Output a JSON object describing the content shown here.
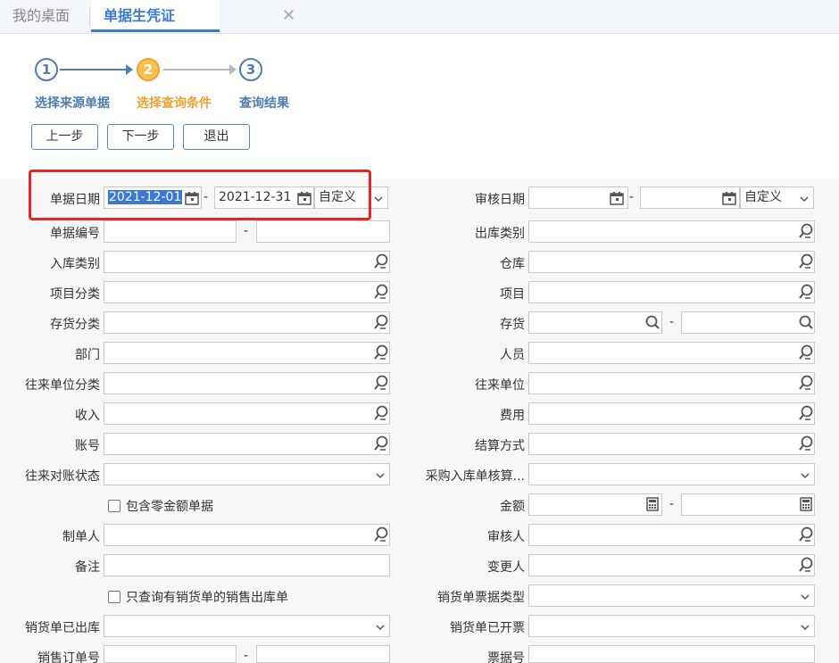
{
  "tabs": [
    {
      "label": "我的桌面"
    },
    {
      "label": "单据生凭证",
      "close": "✕"
    }
  ],
  "steps": [
    {
      "num": "1",
      "label": "选择来源单据"
    },
    {
      "num": "2",
      "label": "选择查询条件"
    },
    {
      "num": "3",
      "label": "查询结果"
    }
  ],
  "buttons": {
    "prev": "上一步",
    "next": "下一步",
    "exit": "退出"
  },
  "colors": {
    "accent": "#3a7bd5",
    "step_active": "#f0a035",
    "step_done": "#4f7cb3",
    "highlight": "#e8262a"
  },
  "form": {
    "doc_date": {
      "label": "单据日期",
      "from": "2021-12-01",
      "to": "2021-12-31",
      "mode": "自定义"
    },
    "audit_date": {
      "label": "审核日期",
      "from": "",
      "to": "",
      "mode": "自定义"
    },
    "doc_no": {
      "label": "单据编号"
    },
    "out_type": {
      "label": "出库类别"
    },
    "in_type": {
      "label": "入库类别"
    },
    "warehouse": {
      "label": "仓库"
    },
    "project_cat": {
      "label": "项目分类"
    },
    "project": {
      "label": "项目"
    },
    "inv_cat": {
      "label": "存货分类"
    },
    "inventory": {
      "label": "存货"
    },
    "dept": {
      "label": "部门"
    },
    "staff": {
      "label": "人员"
    },
    "partner_cat": {
      "label": "往来单位分类"
    },
    "partner": {
      "label": "往来单位"
    },
    "income": {
      "label": "收入"
    },
    "expense": {
      "label": "费用"
    },
    "account": {
      "label": "账号"
    },
    "settle": {
      "label": "结算方式"
    },
    "recon_status": {
      "label": "往来对账状态"
    },
    "purchase_audit": {
      "label": "采购入库单核算..."
    },
    "zero_amount": {
      "label": "包含零金额单据"
    },
    "amount": {
      "label": "金额"
    },
    "maker": {
      "label": "制单人"
    },
    "auditor": {
      "label": "审核人"
    },
    "remark": {
      "label": "备注"
    },
    "changer": {
      "label": "变更人"
    },
    "only_sales": {
      "label": "只查询有销货单的销售出库单"
    },
    "sales_bill_type": {
      "label": "销货单票据类型"
    },
    "sales_out": {
      "label": "销货单已出库"
    },
    "sales_invoiced": {
      "label": "销货单已开票"
    },
    "sales_order": {
      "label": "销售订单号"
    },
    "bill_no": {
      "label": "票据号"
    }
  },
  "icons": [
    "calendar-icon",
    "filter-search-icon",
    "search-icon",
    "calculator-icon",
    "chevron-down-icon",
    "close-icon"
  ]
}
